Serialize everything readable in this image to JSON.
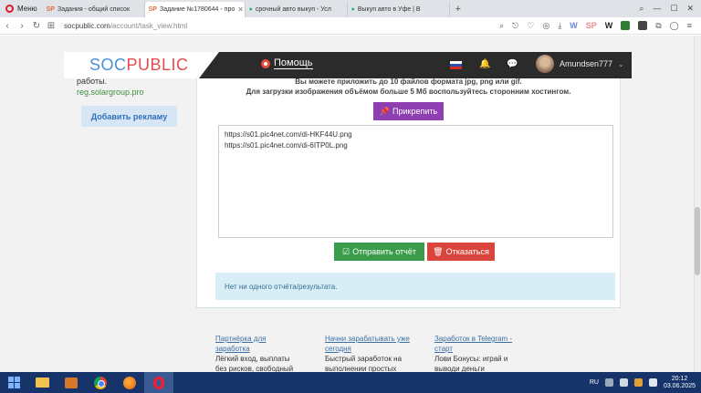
{
  "browser": {
    "menu_label": "Меню",
    "tabs": [
      {
        "icon": "SP",
        "label": "Задания - общий список",
        "active": false
      },
      {
        "icon": "SP",
        "label": "Задание №1780644 - про",
        "active": true
      },
      {
        "icon": "ext",
        "label": "срочный авто выкуп - Усл",
        "active": false
      },
      {
        "icon": "ext",
        "label": "Выкуп авто в Уфе | В",
        "active": false
      }
    ],
    "address": {
      "host": "socpublic.com",
      "path": "/account/task_view.html"
    },
    "extension_badge": "20"
  },
  "site": {
    "logo_part1": "SOC",
    "logo_part2": "PUBLIC",
    "help_label": "Помощь",
    "username": "Amundsen777",
    "colors": {
      "header_bg": "#2b2b2b",
      "logo_blue": "#4a8fd8",
      "logo_red": "#e44c4c"
    }
  },
  "sidebar": {
    "text_line": "работы.",
    "link": "reg.solargroup.pro",
    "add_ad_label": "Добавить рекламу"
  },
  "task": {
    "note_line1": "Вы можете приложить до 10 файлов формата jpg, png или gif.",
    "note_line2": "Для загрузки изображения объёмом больше 5 Мб воспользуйтесь сторонним хостингом.",
    "attach_label": "Прикрепить",
    "report_value": "https://s01.pic4net.com/di-HKF44U.png\nhttps://s01.pic4net.com/di-6ITP0L.png",
    "send_label": "Отправить отчёт",
    "cancel_label": "Отказаться",
    "no_reports_text": "Нет ни одного отчёта/результата.",
    "colors": {
      "attach": "#8e3fb1",
      "send": "#3a9b4a",
      "cancel": "#d9453d",
      "alert_bg": "#d9edf7"
    }
  },
  "footer": {
    "col1_title": [
      "Партнёрка для",
      "заработка"
    ],
    "col1_text": [
      "Лёгкий вход, выплаты",
      "без рисков, свободный"
    ],
    "col2_title": [
      "Начни зарабатывать уже",
      "сегодня"
    ],
    "col2_text": [
      "Быстрый заработок на",
      "выполнении простых"
    ],
    "col3_title": [
      "Заработок в Telegram -",
      "старт"
    ],
    "col3_text": [
      "Лови Бонусы: играй и",
      "выводи деньги"
    ]
  },
  "taskbar": {
    "lang": "RU",
    "time": "20:12",
    "date": "03.06.2025"
  }
}
